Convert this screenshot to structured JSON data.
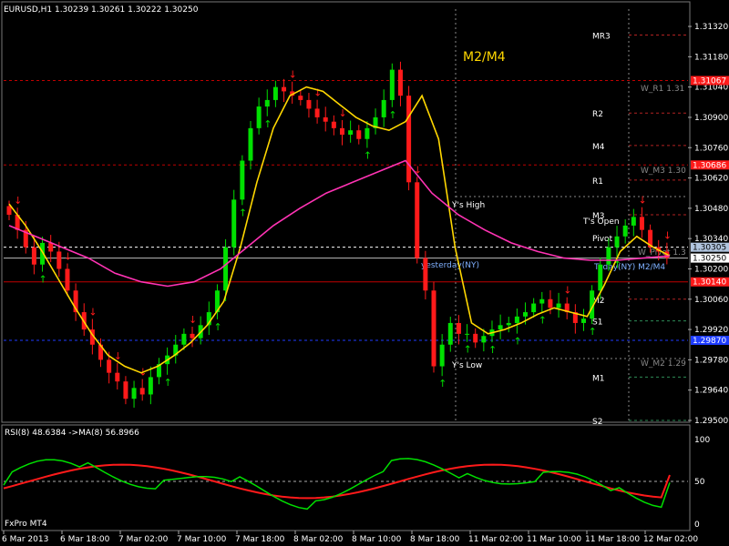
{
  "header": {
    "symbol_info": "EURUSD,H1  1.30239 1.30261 1.30222 1.30250"
  },
  "watermark": "M2/M4",
  "footer_brand": "FxPro MT4",
  "rsi_header": "RSI(8) 48.6384  ->MA(8) 56.8966",
  "colors": {
    "background": "#000000",
    "bull": "#00e000",
    "bear": "#ff1a1a",
    "fast_ma": "#ffd700",
    "slow_ma": "#ff33b4",
    "rsi": "#00e000",
    "rsi_ma": "#ff1a1a",
    "watermark": "#ffd700"
  },
  "price_axis": {
    "ticks": [
      "1.31320",
      "1.31180",
      "1.31040",
      "1.30900",
      "1.30760",
      "1.30620",
      "1.30480",
      "1.30340",
      "1.30200",
      "1.30060",
      "1.29920",
      "1.29780",
      "1.29640",
      "1.29500"
    ],
    "badges": [
      {
        "text": "1.31067",
        "color": "#ff1a1a"
      },
      {
        "text": "1.30686",
        "color": "#ff1a1a"
      },
      {
        "text": "1.30305",
        "color": "#b0c4de"
      },
      {
        "text": "1.30250",
        "color": "#ffffff"
      },
      {
        "text": "1.30140",
        "color": "#ff1a1a"
      },
      {
        "text": "1.29870",
        "color": "#1e3cff"
      }
    ]
  },
  "rsi_axis": {
    "ticks": [
      "100",
      "50",
      "0"
    ]
  },
  "time_axis": {
    "labels": [
      "6 Mar 2013",
      "6 Mar 18:00",
      "7 Mar 02:00",
      "7 Mar 10:00",
      "7 Mar 18:00",
      "8 Mar 02:00",
      "8 Mar 10:00",
      "8 Mar 18:00",
      "11 Mar 02:00",
      "11 Mar 10:00",
      "11 Mar 18:00",
      "12 Mar 02:00"
    ]
  },
  "level_labels": {
    "pivots": [
      "MR3",
      "R2",
      "M4",
      "R1",
      "M3",
      "M2",
      "S1",
      "M1",
      "S2"
    ],
    "weekly": [
      "W_R1 1.31",
      "W_M3 1.30",
      "W_Pivot 1.3",
      "W_M2 1.29"
    ],
    "session": [
      "Y's High",
      "T's Open",
      "Y's Low",
      "yesterday(NY)",
      "Today(NY) M2/M4",
      "Pivot"
    ]
  },
  "chart_data": {
    "type": "candlestick",
    "symbol": "EURUSD",
    "timeframe": "H1",
    "last_quote": {
      "open": 1.30239,
      "high": 1.30261,
      "low": 1.30222,
      "close": 1.3025
    },
    "ylim": [
      1.295,
      1.314
    ],
    "closes": [
      1.3045,
      1.3038,
      1.303,
      1.3022,
      1.3032,
      1.3028,
      1.302,
      1.301,
      1.3,
      1.2992,
      1.2985,
      1.2978,
      1.2972,
      1.2968,
      1.296,
      1.2965,
      1.2962,
      1.297,
      1.2976,
      1.298,
      1.2985,
      1.299,
      1.2988,
      1.2994,
      1.3,
      1.301,
      1.303,
      1.3052,
      1.307,
      1.3085,
      1.3095,
      1.3098,
      1.3104,
      1.3102,
      1.31,
      1.3098,
      1.3094,
      1.309,
      1.3088,
      1.3085,
      1.3082,
      1.3084,
      1.308,
      1.3085,
      1.309,
      1.3098,
      1.3112,
      1.31,
      1.306,
      1.3025,
      1.301,
      1.2975,
      1.2985,
      1.2995,
      1.299,
      1.299,
      1.2986,
      1.2989,
      1.2992,
      1.2994,
      1.2995,
      1.2998,
      1.3,
      1.3004,
      1.3006,
      1.3002,
      1.3004,
      1.3,
      1.2995,
      1.2997,
      1.301,
      1.3022,
      1.303,
      1.3035,
      1.304,
      1.3044,
      1.3038,
      1.303,
      1.3028,
      1.3025
    ],
    "series": [
      {
        "name": "Fast MA",
        "values": [
          1.305,
          1.304,
          1.3028,
          1.3015,
          1.3002,
          1.299,
          1.298,
          1.2975,
          1.2972,
          1.2975,
          1.298,
          1.2986,
          1.2994,
          1.3005,
          1.303,
          1.306,
          1.3085,
          1.31,
          1.3104,
          1.3102,
          1.3096,
          1.309,
          1.3086,
          1.3084,
          1.3088,
          1.31,
          1.308,
          1.303,
          1.2995,
          1.299,
          1.2992,
          1.2995,
          1.2999,
          1.3002,
          1.3,
          1.2998,
          1.3012,
          1.3028,
          1.3035,
          1.303,
          1.3026
        ]
      },
      {
        "name": "Slow MA",
        "values": [
          1.304,
          1.3035,
          1.303,
          1.3025,
          1.3018,
          1.3014,
          1.3012,
          1.3014,
          1.302,
          1.303,
          1.304,
          1.3048,
          1.3055,
          1.306,
          1.3065,
          1.307,
          1.3055,
          1.3045,
          1.3038,
          1.3032,
          1.3028,
          1.3025,
          1.3024,
          1.3024,
          1.3025,
          1.3026
        ]
      }
    ],
    "levels": [
      {
        "name": "MR3",
        "value": 1.3128
      },
      {
        "name": "R2",
        "value": 1.3092
      },
      {
        "name": "M4",
        "value": 1.3077
      },
      {
        "name": "R1",
        "value": 1.3061
      },
      {
        "name": "M3",
        "value": 1.3045
      },
      {
        "name": "M2",
        "value": 1.3006
      },
      {
        "name": "S1",
        "value": 1.2996
      },
      {
        "name": "M1",
        "value": 1.297
      },
      {
        "name": "S2",
        "value": 1.295
      }
    ],
    "rsi": {
      "period": 8,
      "value": 48.6384,
      "ma_period": 8,
      "ma_value": 56.8966,
      "ylim": [
        0,
        100
      ]
    }
  }
}
